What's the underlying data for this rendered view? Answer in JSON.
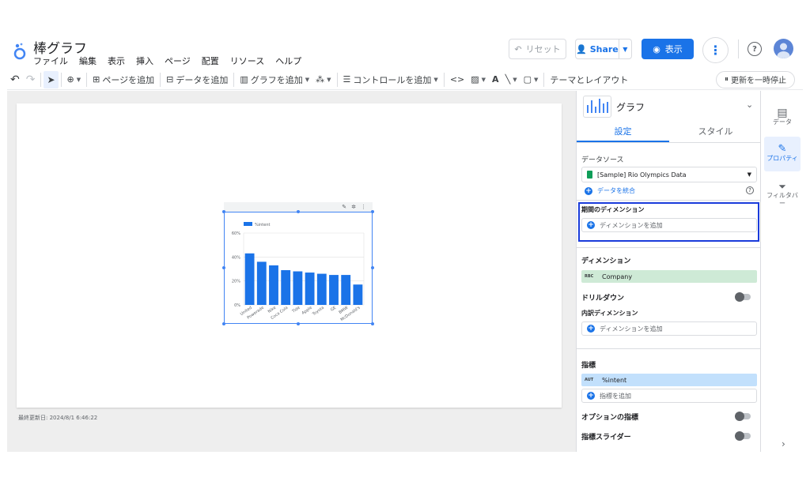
{
  "header": {
    "title": "棒グラフ",
    "menu": [
      "ファイル",
      "編集",
      "表示",
      "挿入",
      "ページ",
      "配置",
      "リソース",
      "ヘルプ"
    ],
    "reset_label": "リセット",
    "share_label": "Share",
    "view_label": "表示"
  },
  "toolbar": {
    "add_page": "ページを追加",
    "add_data": "データを追加",
    "add_chart": "グラフを追加",
    "add_control": "コントロールを追加",
    "theme_layout": "テーマとレイアウト",
    "pause_refresh": "更新を一時停止"
  },
  "canvas": {
    "last_updated": "最終更新日: 2024/8/1 6:46:22"
  },
  "chart_data": {
    "type": "bar",
    "legend": "%intent",
    "categories": [
      "United",
      "Powerade",
      "Nike",
      "Coca Cola",
      "Tide",
      "Apple",
      "Toyota",
      "GE",
      "BMW",
      "McDonald's"
    ],
    "values": [
      43,
      36,
      33,
      29,
      28,
      27,
      26,
      25,
      25,
      17
    ],
    "ylim": [
      0,
      60
    ],
    "yticks": [
      "0%",
      "20%",
      "40%",
      "60%"
    ],
    "grid": true
  },
  "panel": {
    "chart_title": "グラフ",
    "tab_setup": "設定",
    "tab_style": "スタイル",
    "data_source_label": "データソース",
    "data_source_value": "[Sample] Rio Olympics Data",
    "blend_data": "データを統合",
    "date_range_dimension_label": "期間のディメンション",
    "add_dimension": "ディメンションを追加",
    "dimension_label": "ディメンション",
    "dimension_type": "RBC",
    "dimension_value": "Company",
    "drill_down": "ドリルダウン",
    "breakdown_dimension_label": "内訳ディメンション",
    "metric_label": "指標",
    "metric_type": "AUT",
    "metric_value": "%intent",
    "add_metric": "指標を追加",
    "optional_metrics": "オプションの指標",
    "metric_slider": "指標スライダー"
  },
  "rail": {
    "data": "データ",
    "properties": "プロパティ",
    "filter_bar": "フィルタバー"
  }
}
